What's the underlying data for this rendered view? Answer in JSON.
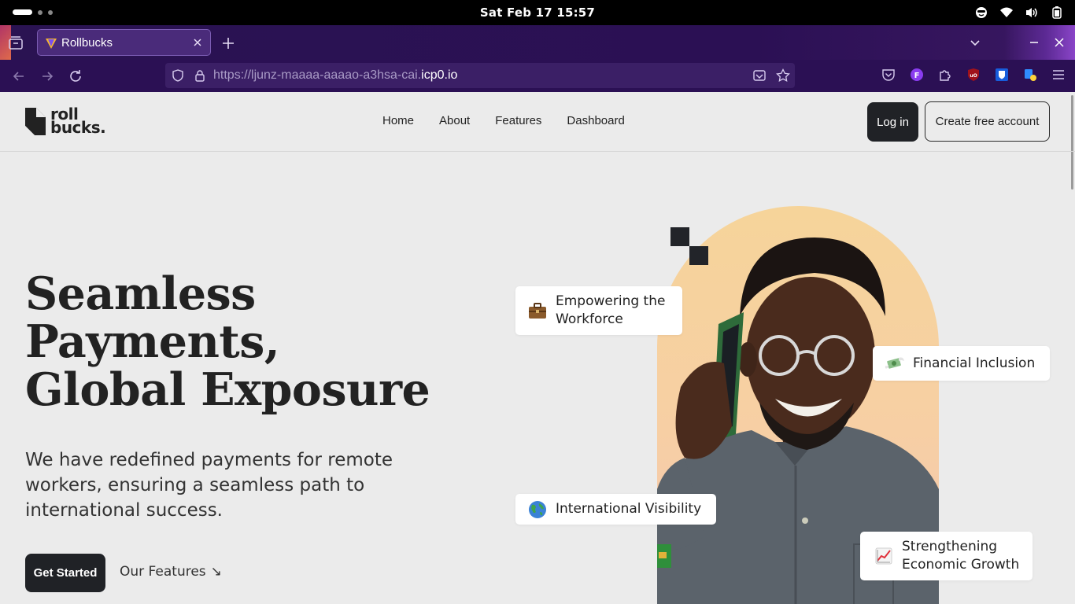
{
  "os_bar": {
    "clock": "Sat Feb 17  15:57"
  },
  "browser": {
    "tab": {
      "title": "Rollbucks"
    },
    "url": {
      "prefix": "https://ljunz-maaaa-aaaao-a3hsa-cai.",
      "domain": "icp0.io"
    },
    "extension_badge_letter": "F"
  },
  "site": {
    "logo": {
      "line1": "roll",
      "line2": "bucks."
    },
    "nav": [
      {
        "label": "Home"
      },
      {
        "label": "About"
      },
      {
        "label": "Features"
      },
      {
        "label": "Dashboard"
      }
    ],
    "login_label": "Log in",
    "signup_label": "Create free account"
  },
  "hero": {
    "title_line1": "Seamless",
    "title_line2": "Payments,",
    "title_line3": "Global Exposure",
    "subtitle": "We have redefined payments for remote workers, ensuring a seamless path to international success.",
    "cta_primary": "Get Started",
    "cta_secondary": "Our Features",
    "cta_secondary_arrow": "↘"
  },
  "feature_cards": [
    {
      "icon": "briefcase-icon",
      "label_line1": "Empowering the",
      "label_line2": "Workforce"
    },
    {
      "icon": "money-with-wings-icon",
      "label_line1": "Financial Inclusion"
    },
    {
      "icon": "globe-icon",
      "label_line1": "International Visibility"
    },
    {
      "icon": "chart-increasing-icon",
      "label_line1": "Strengthening",
      "label_line2": "Economic Growth"
    }
  ],
  "colors": {
    "dark_button": "#202226",
    "page_bg": "#ebebeb",
    "browser_chrome": "#2b1054",
    "arch_peach": "#f6d49a"
  }
}
